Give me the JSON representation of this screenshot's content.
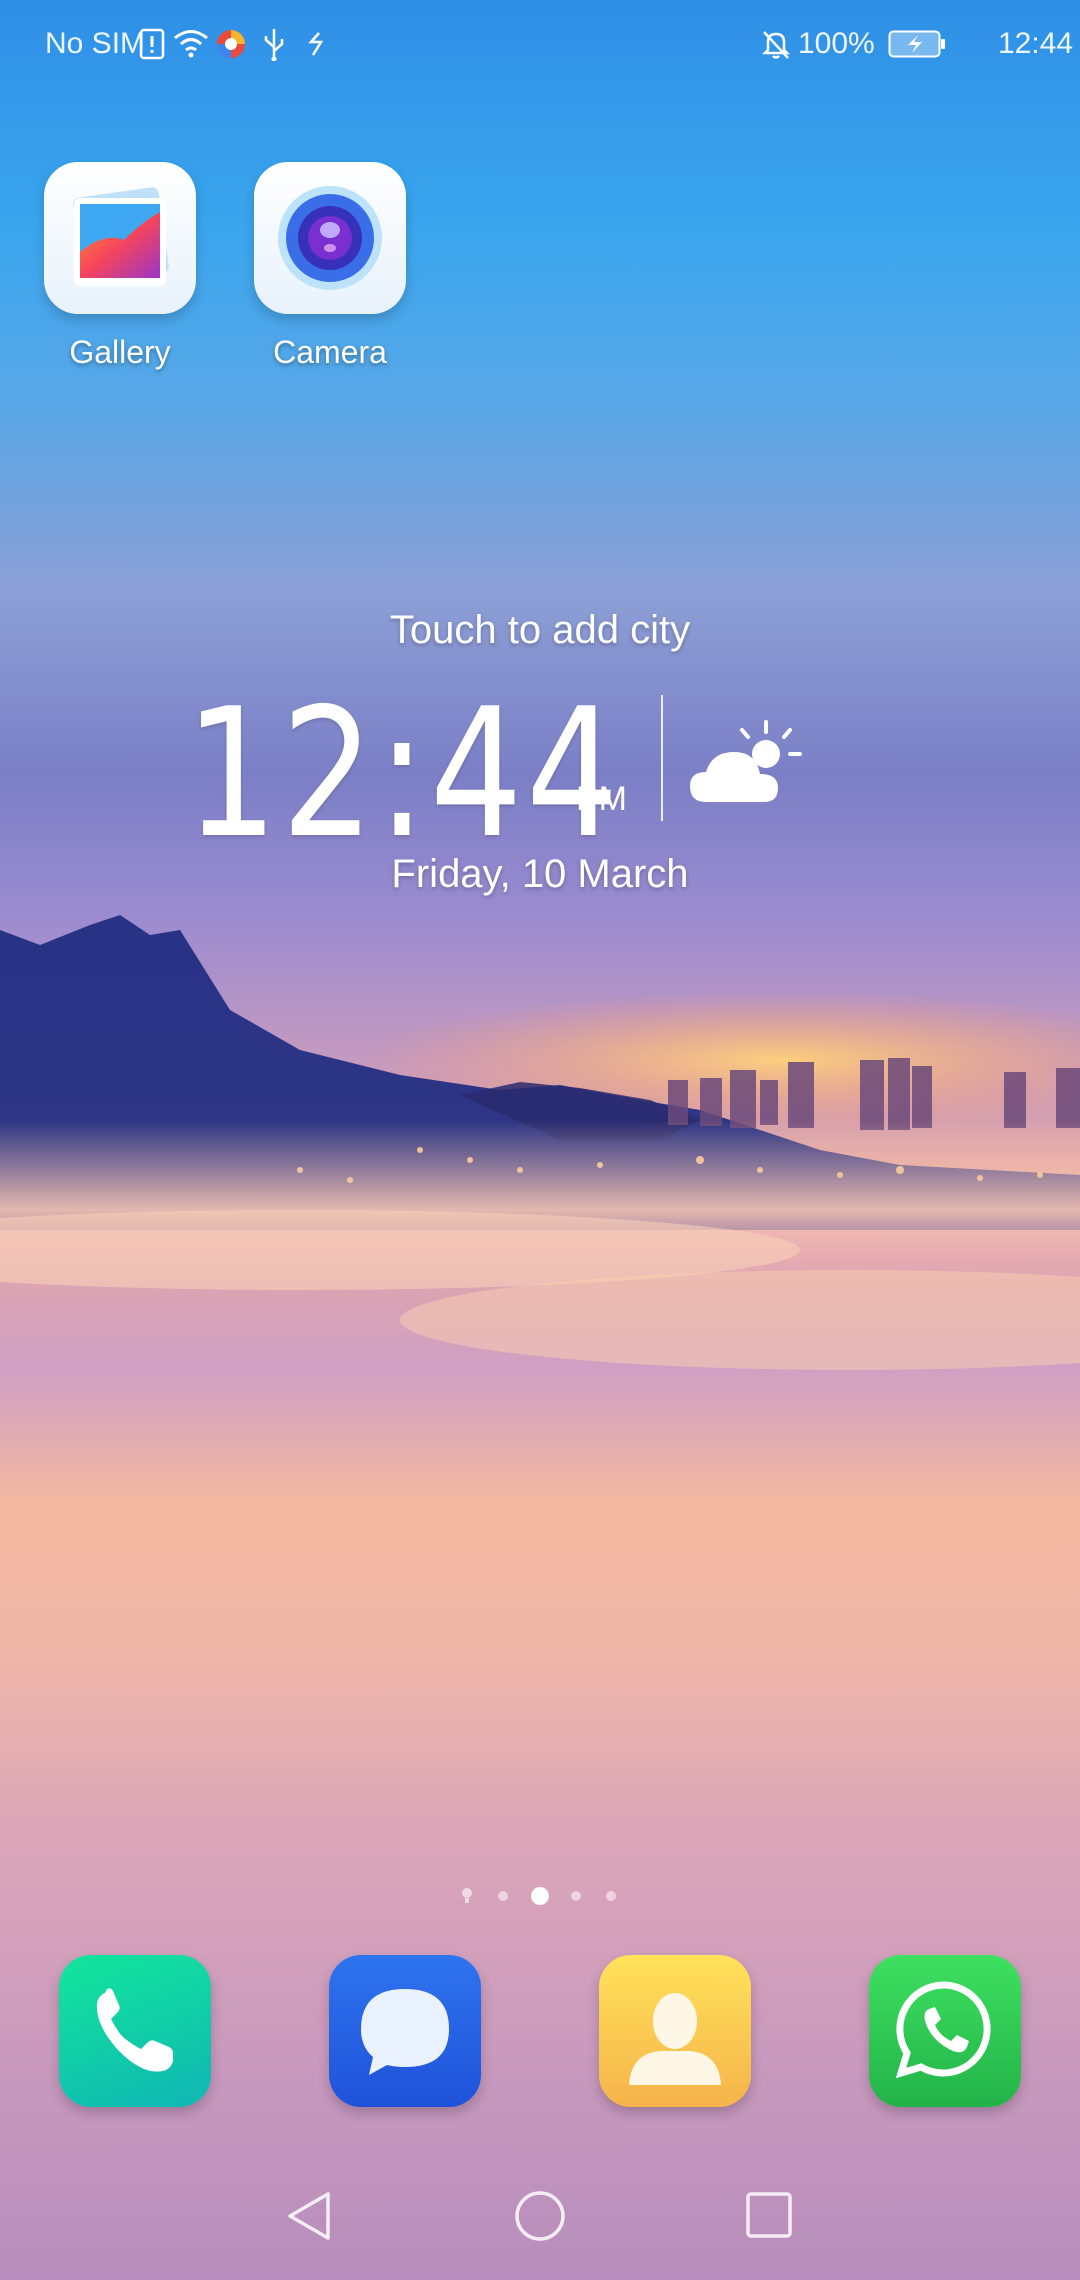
{
  "status_bar": {
    "carrier": "No SIM",
    "battery_percent": "100%",
    "time": "12:44",
    "icons": [
      "sim-alert-icon",
      "wifi-icon",
      "browser-notification-icon",
      "usb-icon",
      "sync-icon",
      "muted-bell-icon",
      "battery-charging-icon"
    ]
  },
  "apps": [
    {
      "label": "Gallery",
      "icon": "gallery-icon"
    },
    {
      "label": "Camera",
      "icon": "camera-icon"
    }
  ],
  "widget": {
    "prompt": "Touch to add city",
    "time": "12:44",
    "ampm": "PM",
    "date": "Friday, 10 March",
    "weather_icon": "partly-sunny-icon"
  },
  "pages": {
    "count": 5,
    "active_index": 2,
    "first_is_hint": true
  },
  "dock": [
    {
      "name": "phone",
      "icon": "phone-icon",
      "color": "#17c98f"
    },
    {
      "name": "messages",
      "icon": "message-bubble-icon",
      "color": "#2a64e8"
    },
    {
      "name": "contacts",
      "icon": "contact-person-icon",
      "color": "#f6c94a"
    },
    {
      "name": "whatsapp",
      "icon": "whatsapp-icon",
      "color": "#31c654"
    }
  ],
  "nav": [
    "back-icon",
    "home-icon",
    "recents-icon"
  ]
}
